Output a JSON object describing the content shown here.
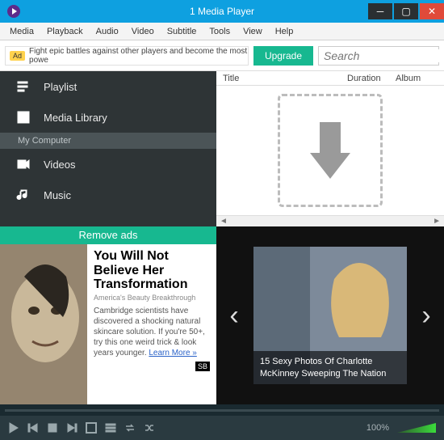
{
  "window": {
    "title": "1 Media Player"
  },
  "menu": {
    "items": [
      "Media",
      "Playback",
      "Audio",
      "Video",
      "Subtitle",
      "Tools",
      "View",
      "Help"
    ]
  },
  "topbar": {
    "ad_badge": "Ad",
    "ad_text": "Fight epic battles against other players and become the most powe",
    "upgrade": "Upgrade",
    "search_placeholder": "Search"
  },
  "sidebar": {
    "playlist": "Playlist",
    "library": "Media Library",
    "mycomputer": "My Computer",
    "videos": "Videos",
    "music": "Music"
  },
  "columns": {
    "title": "Title",
    "duration": "Duration",
    "album": "Album"
  },
  "ads": {
    "remove": "Remove ads",
    "headline": "You Will Not Believe Her Transformation",
    "subhead": "America's Beauty Breakthrough",
    "body": "Cambridge scientists have discovered a shocking natural skincare solution. If you're 50+, try this one weird trick & look years younger.  ",
    "learn": "Learn More »",
    "carousel_caption": "15 Sexy Photos Of Charlotte McKinney Sweeping The Nation"
  },
  "player": {
    "volume_pct": "100%"
  }
}
